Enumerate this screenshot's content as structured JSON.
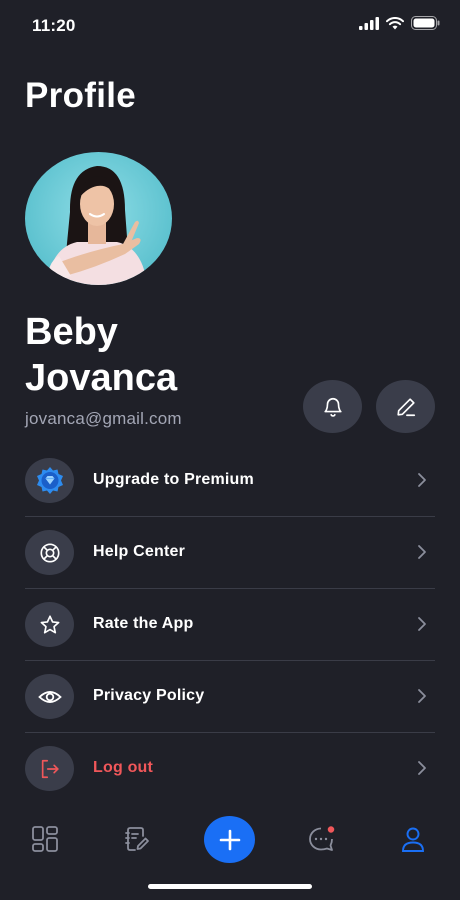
{
  "status_bar": {
    "time": "11:20"
  },
  "page": {
    "title": "Profile"
  },
  "profile": {
    "first_name": "Beby",
    "last_name": "Jovanca",
    "email": "jovanca@gmail.com"
  },
  "menu": {
    "items": [
      {
        "label": "Upgrade to Premium",
        "icon": "diamond-icon"
      },
      {
        "label": "Help Center",
        "icon": "lifebuoy-icon"
      },
      {
        "label": "Rate the App",
        "icon": "star-icon"
      },
      {
        "label": "Privacy Policy",
        "icon": "eye-icon"
      },
      {
        "label": "Log out",
        "icon": "logout-icon"
      }
    ]
  },
  "tab_bar": {
    "tabs": [
      "dashboard-icon",
      "notebook-icon",
      "plus-icon",
      "chat-icon",
      "profile-icon"
    ],
    "active": "profile-icon"
  },
  "colors": {
    "background": "#1f2028",
    "icon_bg": "#3a3d4a",
    "accent": "#1a6ff5",
    "danger": "#f0575a",
    "muted_text": "#a3a6b5"
  }
}
